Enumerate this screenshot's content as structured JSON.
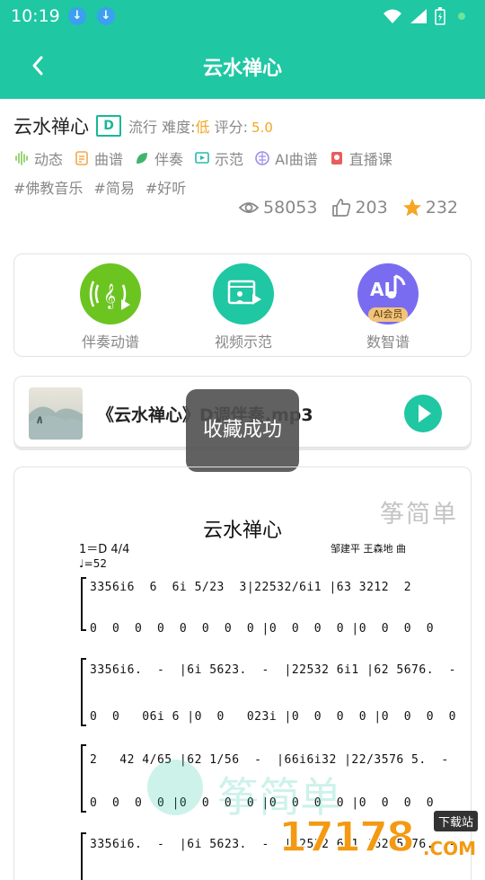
{
  "status": {
    "time": "10:19"
  },
  "header": {
    "title": "云水禅心"
  },
  "song": {
    "name": "云水禅心",
    "key": "D",
    "genre": "流行",
    "difficulty_label": "难度:",
    "difficulty": "低",
    "rating_label": "评分:",
    "rating": "5.0"
  },
  "tags": [
    {
      "icon": "sound-wave-icon",
      "label": "动态"
    },
    {
      "icon": "score-sheet-icon",
      "label": "曲谱"
    },
    {
      "icon": "leaf-icon",
      "label": "伴奏"
    },
    {
      "icon": "demo-screen-icon",
      "label": "示范"
    },
    {
      "icon": "brain-icon",
      "label": "AI曲谱"
    },
    {
      "icon": "live-class-icon",
      "label": "直播课"
    }
  ],
  "hashtags": [
    "#佛教音乐",
    "#简易",
    "#好听"
  ],
  "stats": {
    "views": "58053",
    "likes": "203",
    "favorites": "232"
  },
  "features": [
    {
      "label": "伴奏动谱",
      "icon": "music-note-icon",
      "color": "#6cc421"
    },
    {
      "label": "视频示范",
      "icon": "video-demo-icon",
      "color": "#1fc7a3"
    },
    {
      "label": "数智谱",
      "icon": "ai-music-icon",
      "badge": "AI会员",
      "color": "#7a6cf0"
    }
  ],
  "player": {
    "track": "《云水禅心》D调伴奏.mp3"
  },
  "toast": "收藏成功",
  "sheet": {
    "brand": "筝简单",
    "title": "云水禅心",
    "composer": "邹建平 王森地 曲",
    "key_signature": "1＝D 4/4",
    "tempo": "♩=52",
    "rows": [
      "3356i6  6  6i 5/23  3|22532/6i1 |63 3212  2",
      "0  0  0  0  0  0  0  0 |0  0  0  0 |0  0  0  0",
      "3356i6.  -  |6i 5623.  -  |22532 6i1 |62 5676.  -",
      "0  0   06i 6 |0  0   023i |0  0  0  0 |0  0  0  0",
      "2   42 4/65 |62 1/56  -  |66i6i32 |22/3576 5.  -",
      "0  0  0  0 |0  0  0  0 |0  0  0  0 |0  0  0  0",
      "3356i6.  -  |6i 5623.  -  |22532 6i1 |62 5676.  -"
    ],
    "watermark": "筝简单"
  },
  "site_logo": {
    "numbers": "17178",
    "badge": "下载站",
    "suffix": ".COM"
  }
}
